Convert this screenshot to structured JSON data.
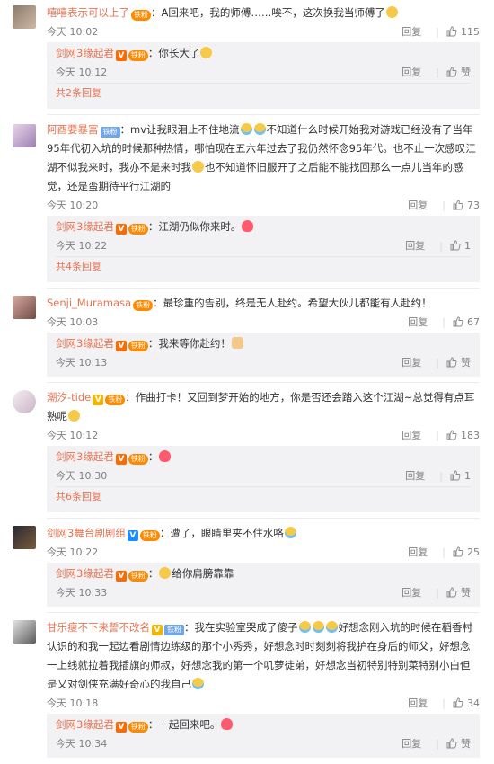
{
  "reply_label": "回复",
  "like_text": "赞",
  "comments": [
    {
      "user": "嘻嘻表示可以上了",
      "text": "：A回来吧，我的师傅……唉不，这次换我当师傅了",
      "time": "今天 10:02",
      "likes": "115",
      "badges": [
        "fan"
      ],
      "emoji_after": [
        "smile"
      ],
      "sub": [
        {
          "user": "剑网3缘起君",
          "text": "：你长大了",
          "time": "今天 10:12",
          "likes": "赞",
          "emoji_after": [
            "smile"
          ]
        }
      ],
      "more": "共2条回复"
    },
    {
      "user": "阿酉要暴富",
      "text_parts": [
        "：mv让我眼泪止不住地流",
        "不知道什么时候开始我对游戏已经没有了当年95年代初入坑的时候那种热情，哪怕现在五六年过去了我仍然怀念95年代。也不止一次感叹江湖不似我来时，我亦不是来时我",
        "也不知道怀旧服开了之后能不能找回那么一点儿当年的感觉，还是蛮期待平行江湖的"
      ],
      "time": "今天 10:20",
      "likes": "73",
      "sub": [
        {
          "user": "剑网3缘起君",
          "text": "：江湖仍似你来时。",
          "time": "今天 10:22",
          "likes": "1"
        }
      ],
      "more": "共4条回复"
    },
    {
      "user": "Senji_Muramasa",
      "text": "：最珍重的告别，终是无人赴约。希望大伙儿都能有人赴约！",
      "time": "今天 10:03",
      "likes": "67",
      "sub": [
        {
          "user": "剑网3缘起君",
          "text": "：我来等你赴约！",
          "time": "今天 10:13",
          "likes": "赞"
        }
      ]
    },
    {
      "user": "潮汐-tide",
      "text": "：作曲打卡！又回到梦开始的地方，你是否还会踏入这个江湖~总觉得有点耳熟呢",
      "time": "今天 10:12",
      "likes": "183",
      "sub": [
        {
          "user": "剑网3缘起君",
          "text": "：",
          "time": "今天 10:30",
          "likes": "1"
        }
      ],
      "more": "共6条回复"
    },
    {
      "user": "剑网3舞台剧剧组",
      "text": "：遭了，眼睛里夹不住水咯",
      "time": "今天 10:22",
      "likes": "25",
      "sub": [
        {
          "user": "剑网3缘起君",
          "text": "给你肩膀靠靠",
          "time": "今天 10:33",
          "likes": "赞"
        }
      ]
    },
    {
      "user": "甘乐瘦不下来誓不改名",
      "text_parts": [
        "：我在实验室哭成了傻子",
        "好想念刚入坑的时候在稻香村认识的和我一起边看剧情边练级的那个小秀秀，好想念时时刻刻将我护在身后的师父，好想念一上线就拉着我插旗的师叔，好想念我的第一个叽萝徒弟，好想念当初特别特别菜特别小白但是又对剑侠充满好奇心的我自己"
      ],
      "time": "今天 10:18",
      "likes": "34",
      "sub": [
        {
          "user": "剑网3缘起君",
          "text": "：一起回来吧。",
          "time": "今天 10:34",
          "likes": "赞"
        }
      ]
    }
  ],
  "badges": {
    "fan_label": "铁粉",
    "iron_label": "铁粉"
  }
}
